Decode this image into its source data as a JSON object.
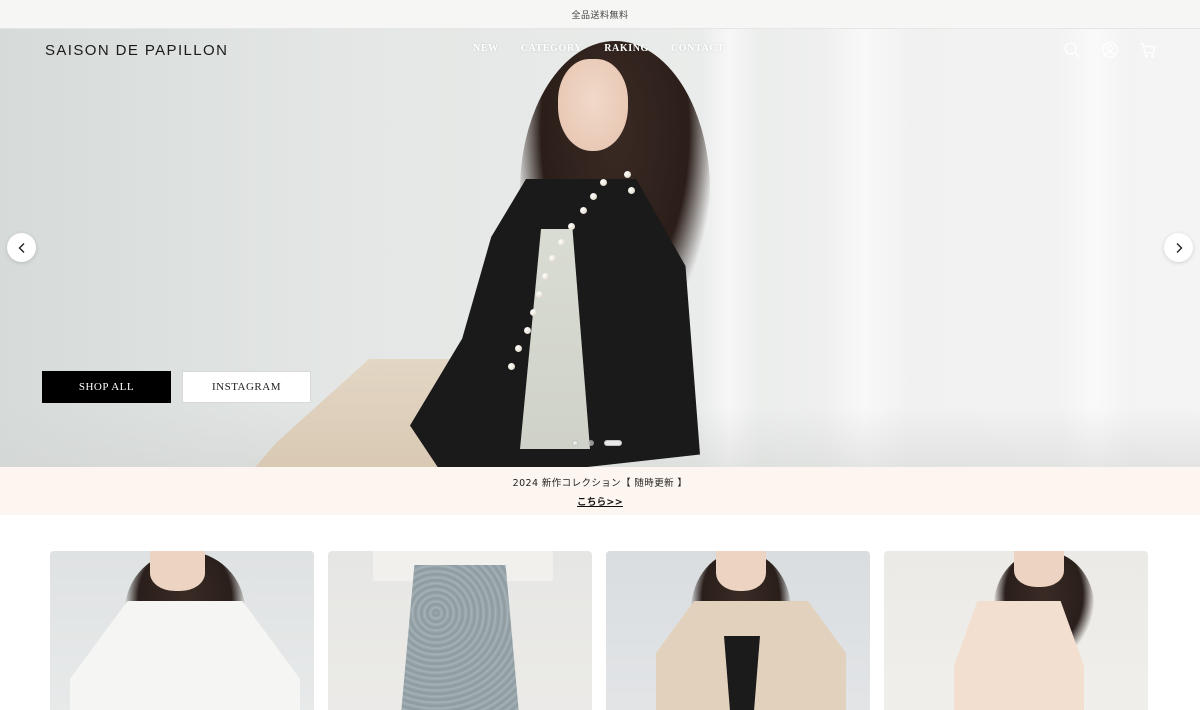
{
  "announcement": {
    "text": "全品送料無料"
  },
  "header": {
    "logo": "SAISON DE PAPILLON",
    "nav": [
      "NEW",
      "CATEGORY",
      "RAKING",
      "CONTACT"
    ],
    "icons": [
      "search-icon",
      "account-icon",
      "cart-icon"
    ]
  },
  "hero": {
    "buttons": {
      "shop_all": "SHOP ALL",
      "instagram": "INSTAGRAM"
    },
    "slides": {
      "count": 3,
      "active": 3
    },
    "arrows": [
      "chevron-left-icon",
      "chevron-right-icon"
    ]
  },
  "promo": {
    "line1": "2024 新作コレクション【 随時更新 】",
    "line2": "こちら>>"
  },
  "products": [
    {
      "name": "white-blouse-look"
    },
    {
      "name": "blue-jacquard-skirt-look"
    },
    {
      "name": "beige-jacket-look"
    },
    {
      "name": "ivory-dress-look"
    }
  ],
  "colors": {
    "announce_bg": "#f6f6f5",
    "promo_bg": "#fdf5ef",
    "shop_btn": "#000000",
    "nav_text": "#ffffff"
  }
}
